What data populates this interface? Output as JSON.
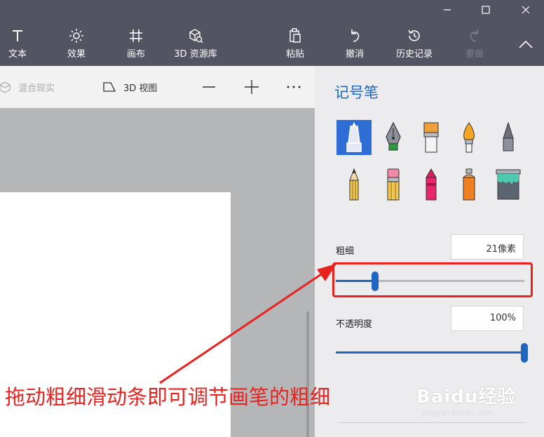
{
  "toolbar": {
    "tools": [
      {
        "id": "text",
        "label": "文本"
      },
      {
        "id": "effects",
        "label": "效果"
      },
      {
        "id": "canvas",
        "label": "画布"
      },
      {
        "id": "library3d",
        "label": "3D 资源库"
      },
      {
        "id": "paste",
        "label": "粘贴"
      },
      {
        "id": "undo",
        "label": "撤消"
      },
      {
        "id": "history",
        "label": "历史记录"
      },
      {
        "id": "redo",
        "label": "重做"
      }
    ]
  },
  "subbar": {
    "mixed_reality": "混合现实",
    "view3d": "3D 视图"
  },
  "panel": {
    "title": "记号笔",
    "brushes": [
      "marker",
      "calligraphy-pen",
      "oil-brush",
      "watercolor",
      "pencil-tip",
      "pencil",
      "eraser",
      "crayon",
      "spray-can",
      "fill-bucket"
    ],
    "thickness": {
      "label": "粗细",
      "value_text": "21像素",
      "fraction": 0.21
    },
    "opacity": {
      "label": "不透明度",
      "value_text": "100%",
      "fraction": 1.0
    }
  },
  "annotation": {
    "text": "拖动粗细滑动条即可调节画笔的粗细",
    "color": "#e8231f"
  },
  "watermark": {
    "main": "Baidu经验",
    "sub": "jingyan.baidu.com"
  },
  "colors": {
    "accent": "#1f66c1",
    "chrome": "#535362"
  }
}
